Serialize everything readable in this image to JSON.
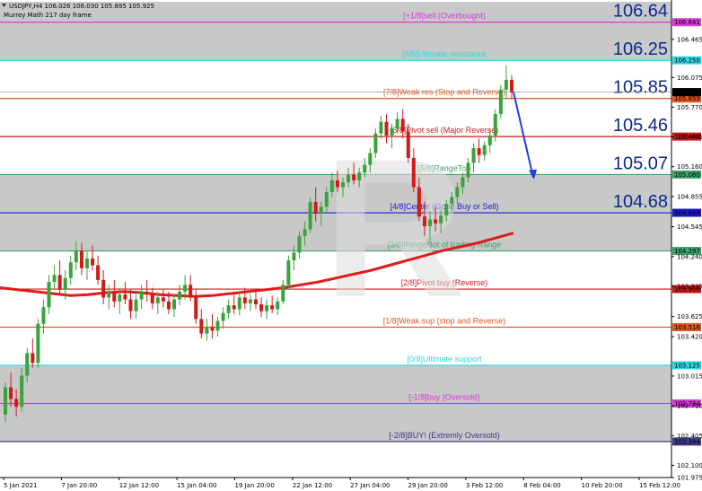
{
  "header": {
    "symbol_line": "USDJPY,H4  106.026 106.030 105.895 105.925",
    "indicator_line": "Murrey Math 217 day frame"
  },
  "colors": {
    "bull": "#3aa33a",
    "bear": "#d11a1a",
    "ma": "#e01b1b",
    "arrow": "#1f3fe6",
    "band": "#c8c8c8",
    "grid": "#cfcfcf"
  },
  "chart_data": {
    "type": "candlestick",
    "title": "",
    "ylim": [
      101.975,
      106.85
    ],
    "y_ticks": [
      "106.465",
      "106.075",
      "105.770",
      "105.465",
      "105.160",
      "104.855",
      "104.545",
      "104.240",
      "103.935",
      "103.625",
      "103.420",
      "103.015",
      "102.710",
      "102.405",
      "102.100",
      "101.975"
    ],
    "x_ticks": [
      "5 Jan 2021",
      "7 Jan 20:00",
      "12 Jan 12:00",
      "15 Jan 04:00",
      "19 Jan 20:00",
      "22 Jan 12:00",
      "27 Jan 04:00",
      "29 Jan 20:00",
      "3 Feb 12:00",
      "8 Feb 04:00",
      "10 Feb 20:00",
      "15 Feb 12:00"
    ],
    "current_price": "105.925",
    "current_price_level": 105.925,
    "price_tags": [
      {
        "text": "105.859",
        "level": 105.859,
        "color": "#e0571f"
      }
    ],
    "murrey_levels": [
      {
        "level": 106.641,
        "tag": "106.641",
        "label": "[+1/8]sell (Overbought)",
        "color": "#d63bd6",
        "big": "106.64"
      },
      {
        "level": 106.25,
        "tag": "106.250",
        "label": "[8/8]Ultimate resistance",
        "color": "#33d6e0",
        "big": "106.25"
      },
      {
        "level": 105.859,
        "tag": "105.859",
        "label": "[7/8]Weak res (Stop and Reverse)",
        "color": "#e0571f",
        "big": "105.85"
      },
      {
        "level": 105.469,
        "tag": "105.469",
        "label": "[6/8]Pivot sell (Major Reverse)",
        "color": "#d11a1a",
        "big": "105.46"
      },
      {
        "level": 105.08,
        "tag": "105.080",
        "label": "[5/8]RangeTop",
        "color": "#3aa36a",
        "big": "105.07"
      },
      {
        "level": 104.688,
        "tag": "104.688",
        "label": "[4/8]Center (Good Buy or Sell)",
        "color": "#1a1ad1",
        "big": "104.68"
      },
      {
        "level": 104.297,
        "tag": "104.297",
        "label": "[3/8]RangeBot of trading Range",
        "color": "#3aa36a",
        "big": ""
      },
      {
        "level": 103.906,
        "tag": "103.906",
        "label": "[2/8]Pivot buy (Reverse)",
        "color": "#d11a1a",
        "big": ""
      },
      {
        "level": 103.516,
        "tag": "103.516",
        "label": "[1/8]Weak sup (stop and Reverse)",
        "color": "#e0571f",
        "big": ""
      },
      {
        "level": 103.125,
        "tag": "103.125",
        "label": "[0/8]Ultimate support",
        "color": "#33d6e0",
        "big": ""
      },
      {
        "level": 102.734,
        "tag": "102.734",
        "label": "[-1/8]buy (Oversold)",
        "color": "#d63bd6",
        "big": ""
      },
      {
        "level": 102.344,
        "tag": "102.344",
        "label": "[-2/8]BUY! (Extremly Oversold)",
        "color": "#3a3a8a",
        "big": ""
      }
    ],
    "shaded_bands": [
      [
        106.25,
        106.85
      ],
      [
        104.688,
        105.08
      ],
      [
        104.297,
        104.688
      ],
      [
        102.344,
        103.125
      ]
    ],
    "candles": [
      [
        102.62,
        102.95,
        102.55,
        102.9
      ],
      [
        102.9,
        103.05,
        102.7,
        102.78
      ],
      [
        102.78,
        102.88,
        102.6,
        102.7
      ],
      [
        102.7,
        103.1,
        102.65,
        103.02
      ],
      [
        103.02,
        103.3,
        102.95,
        103.25
      ],
      [
        103.25,
        103.4,
        103.1,
        103.15
      ],
      [
        103.15,
        103.6,
        103.1,
        103.55
      ],
      [
        103.55,
        103.8,
        103.45,
        103.72
      ],
      [
        103.72,
        104.05,
        103.65,
        103.98
      ],
      [
        103.98,
        104.15,
        103.9,
        104.05
      ],
      [
        104.05,
        104.2,
        103.85,
        103.9
      ],
      [
        103.9,
        104.1,
        103.8,
        104.02
      ],
      [
        104.02,
        104.25,
        103.95,
        104.18
      ],
      [
        104.18,
        104.4,
        104.1,
        104.3
      ],
      [
        104.3,
        104.38,
        104.05,
        104.12
      ],
      [
        104.12,
        104.3,
        104.0,
        104.22
      ],
      [
        104.22,
        104.35,
        104.1,
        104.15
      ],
      [
        104.15,
        104.25,
        103.95,
        104.0
      ],
      [
        104.0,
        104.1,
        103.75,
        103.82
      ],
      [
        103.82,
        103.95,
        103.7,
        103.88
      ],
      [
        103.88,
        104.0,
        103.72,
        103.78
      ],
      [
        103.78,
        103.92,
        103.65,
        103.85
      ],
      [
        103.85,
        103.98,
        103.75,
        103.8
      ],
      [
        103.8,
        103.9,
        103.6,
        103.68
      ],
      [
        103.68,
        103.85,
        103.6,
        103.8
      ],
      [
        103.8,
        103.95,
        103.7,
        103.88
      ],
      [
        103.88,
        104.0,
        103.78,
        103.85
      ],
      [
        103.85,
        103.92,
        103.7,
        103.76
      ],
      [
        103.76,
        103.88,
        103.65,
        103.82
      ],
      [
        103.82,
        103.9,
        103.72,
        103.78
      ],
      [
        103.78,
        103.88,
        103.65,
        103.7
      ],
      [
        103.7,
        103.85,
        103.62,
        103.8
      ],
      [
        103.8,
        103.95,
        103.74,
        103.88
      ],
      [
        103.88,
        104.05,
        103.8,
        103.95
      ],
      [
        103.95,
        104.05,
        103.78,
        103.82
      ],
      [
        103.82,
        103.9,
        103.55,
        103.6
      ],
      [
        103.6,
        103.7,
        103.4,
        103.45
      ],
      [
        103.45,
        103.6,
        103.38,
        103.52
      ],
      [
        103.52,
        103.65,
        103.4,
        103.48
      ],
      [
        103.48,
        103.62,
        103.42,
        103.58
      ],
      [
        103.58,
        103.72,
        103.5,
        103.66
      ],
      [
        103.66,
        103.8,
        103.6,
        103.74
      ],
      [
        103.74,
        103.85,
        103.65,
        103.7
      ],
      [
        103.7,
        103.88,
        103.64,
        103.82
      ],
      [
        103.82,
        103.92,
        103.7,
        103.76
      ],
      [
        103.76,
        103.86,
        103.68,
        103.8
      ],
      [
        103.8,
        103.9,
        103.7,
        103.75
      ],
      [
        103.75,
        103.82,
        103.62,
        103.68
      ],
      [
        103.68,
        103.8,
        103.6,
        103.74
      ],
      [
        103.74,
        103.84,
        103.66,
        103.7
      ],
      [
        103.7,
        103.82,
        103.64,
        103.78
      ],
      [
        103.78,
        104.0,
        103.75,
        103.95
      ],
      [
        103.95,
        104.25,
        103.9,
        104.2
      ],
      [
        104.2,
        104.35,
        104.1,
        104.28
      ],
      [
        104.28,
        104.5,
        104.22,
        104.45
      ],
      [
        104.45,
        104.6,
        104.35,
        104.52
      ],
      [
        104.52,
        104.85,
        104.48,
        104.8
      ],
      [
        104.8,
        104.95,
        104.6,
        104.68
      ],
      [
        104.68,
        104.8,
        104.55,
        104.75
      ],
      [
        104.75,
        104.95,
        104.7,
        104.9
      ],
      [
        104.9,
        105.1,
        104.85,
        105.02
      ],
      [
        105.02,
        105.12,
        104.9,
        104.95
      ],
      [
        104.95,
        105.05,
        104.85,
        105.0
      ],
      [
        105.0,
        105.15,
        104.95,
        105.08
      ],
      [
        105.08,
        105.2,
        104.98,
        105.02
      ],
      [
        105.02,
        105.15,
        104.95,
        105.1
      ],
      [
        105.1,
        105.25,
        105.05,
        105.18
      ],
      [
        105.18,
        105.35,
        105.1,
        105.3
      ],
      [
        105.3,
        105.55,
        105.25,
        105.5
      ],
      [
        105.5,
        105.68,
        105.45,
        105.62
      ],
      [
        105.62,
        105.7,
        105.4,
        105.48
      ],
      [
        105.48,
        105.6,
        105.35,
        105.55
      ],
      [
        105.55,
        105.72,
        105.5,
        105.65
      ],
      [
        105.65,
        105.75,
        105.45,
        105.52
      ],
      [
        105.52,
        105.6,
        105.2,
        105.25
      ],
      [
        105.25,
        105.35,
        104.9,
        104.95
      ],
      [
        104.95,
        105.05,
        104.6,
        104.65
      ],
      [
        104.65,
        104.8,
        104.45,
        104.55
      ],
      [
        104.55,
        104.7,
        104.4,
        104.62
      ],
      [
        104.62,
        104.75,
        104.5,
        104.58
      ],
      [
        104.58,
        104.72,
        104.48,
        104.66
      ],
      [
        104.66,
        104.82,
        104.6,
        104.78
      ],
      [
        104.78,
        104.9,
        104.7,
        104.85
      ],
      [
        104.85,
        105.0,
        104.78,
        104.95
      ],
      [
        104.95,
        105.1,
        104.88,
        105.05
      ],
      [
        105.05,
        105.25,
        105.0,
        105.2
      ],
      [
        105.2,
        105.4,
        105.1,
        105.35
      ],
      [
        105.35,
        105.45,
        105.2,
        105.28
      ],
      [
        105.28,
        105.42,
        105.22,
        105.38
      ],
      [
        105.38,
        105.55,
        105.3,
        105.48
      ],
      [
        105.48,
        105.75,
        105.42,
        105.7
      ],
      [
        105.7,
        106.0,
        105.65,
        105.95
      ],
      [
        105.95,
        106.2,
        105.85,
        106.05
      ],
      [
        106.05,
        106.1,
        105.85,
        105.925
      ]
    ],
    "ma_series": [
      103.92,
      103.9,
      103.88,
      103.86,
      103.84,
      103.85,
      103.87,
      103.88,
      103.87,
      103.85,
      103.84,
      103.83,
      103.84,
      103.86,
      103.88,
      103.9,
      103.92,
      103.95,
      103.98,
      104.02,
      104.06,
      104.1,
      104.15,
      104.2,
      104.25,
      104.3,
      104.34,
      104.38,
      104.43,
      104.48
    ],
    "forecast_arrow": {
      "from_level": 105.925,
      "to_level": 105.05
    }
  }
}
